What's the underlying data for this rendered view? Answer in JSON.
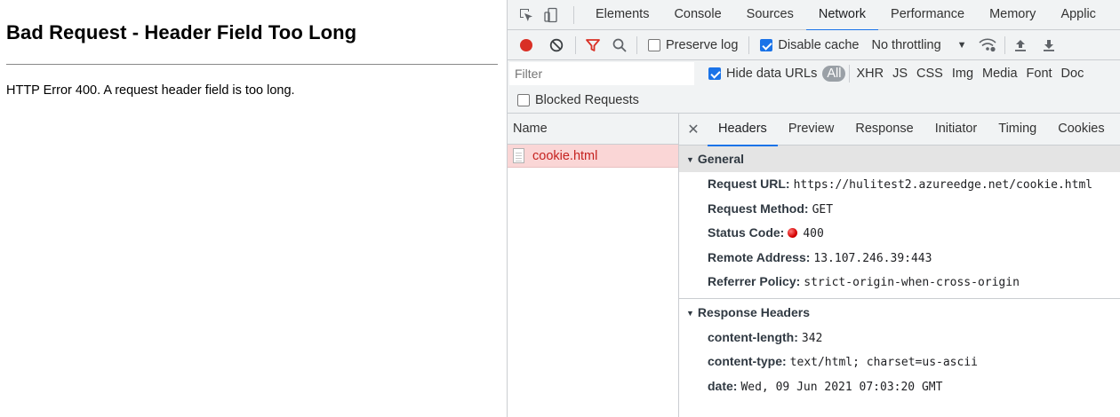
{
  "page": {
    "heading": "Bad Request - Header Field Too Long",
    "message": "HTTP Error 400. A request header field is too long."
  },
  "devtools": {
    "tabs": [
      "Elements",
      "Console",
      "Sources",
      "Network",
      "Performance",
      "Memory",
      "Applic"
    ],
    "active_tab": "Network",
    "toolbar": {
      "preserve_log": "Preserve log",
      "disable_cache": "Disable cache",
      "throttling": "No throttling",
      "preserve_log_checked": false,
      "disable_cache_checked": true
    },
    "filter": {
      "placeholder": "Filter",
      "hide_data_urls": "Hide data URLs",
      "hide_data_urls_checked": true,
      "types": [
        "All",
        "XHR",
        "JS",
        "CSS",
        "Img",
        "Media",
        "Font",
        "Doc"
      ]
    },
    "blocked_requests": "Blocked Requests",
    "name_header": "Name",
    "requests": [
      {
        "name": "cookie.html",
        "status": "error"
      }
    ],
    "details": {
      "tabs": [
        "Headers",
        "Preview",
        "Response",
        "Initiator",
        "Timing",
        "Cookies"
      ],
      "active_tab": "Headers",
      "general_title": "General",
      "general": [
        {
          "key": "Request URL:",
          "value": "https://hulitest2.azureedge.net/cookie.html"
        },
        {
          "key": "Request Method:",
          "value": "GET"
        },
        {
          "key": "Status Code:",
          "value": "400"
        },
        {
          "key": "Remote Address:",
          "value": "13.107.246.39:443"
        },
        {
          "key": "Referrer Policy:",
          "value": "strict-origin-when-cross-origin"
        }
      ],
      "response_headers_title": "Response Headers",
      "response_headers": [
        {
          "key": "content-length:",
          "value": "342"
        },
        {
          "key": "content-type:",
          "value": "text/html; charset=us-ascii"
        },
        {
          "key": "date:",
          "value": "Wed, 09 Jun 2021 07:03:20 GMT"
        }
      ]
    },
    "colors": {
      "accent": "#1a73e8",
      "error_row_bg": "#fad6d6",
      "error_text": "#c5221f",
      "record": "#d93025"
    }
  }
}
